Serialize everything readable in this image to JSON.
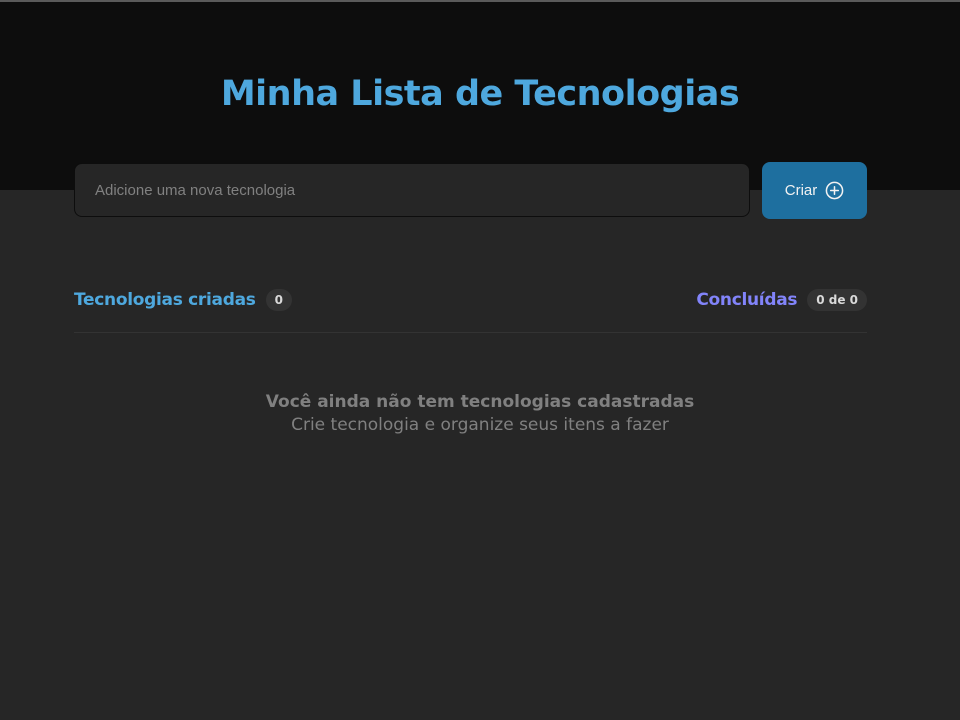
{
  "header": {
    "title": "Minha Lista de Tecnologias"
  },
  "form": {
    "input_value": "",
    "input_placeholder": "Adicione uma nova tecnologia",
    "create_label": "Criar",
    "create_icon": "plus-circle-icon"
  },
  "summary": {
    "created_label": "Tecnologias criadas",
    "created_count": "0",
    "done_label": "Concluídas",
    "done_count": "0 de 0"
  },
  "empty_state": {
    "title": "Você ainda não tem tecnologias cadastradas",
    "subtitle": "Crie tecnologia e organize seus itens a fazer"
  },
  "colors": {
    "header_bg": "#0d0d0d",
    "page_bg": "#262626",
    "accent_blue": "#4ea8de",
    "accent_purple": "#8284fa",
    "button_bg": "#1e6f9f"
  }
}
